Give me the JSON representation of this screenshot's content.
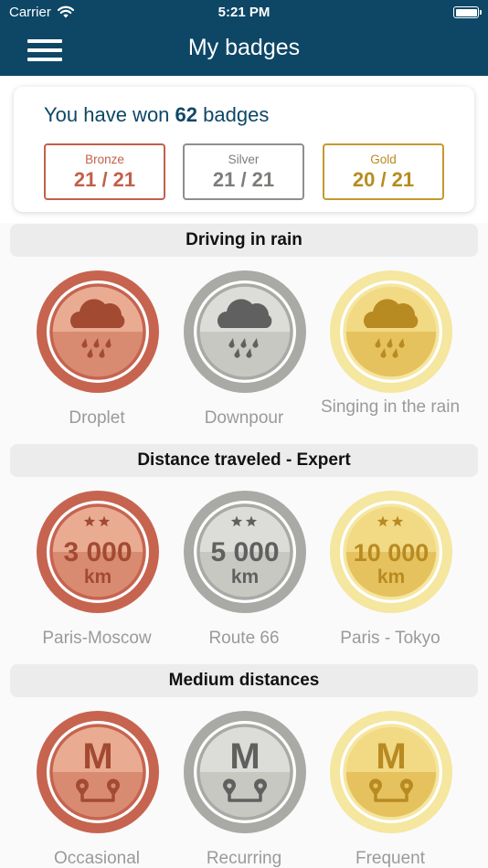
{
  "status_bar": {
    "carrier": "Carrier",
    "time": "5:21 PM",
    "wifi_icon": "wifi-icon",
    "battery_icon": "battery-icon"
  },
  "nav": {
    "title": "My badges",
    "menu_icon": "hamburger-menu-icon"
  },
  "summary": {
    "prefix": "You have won",
    "count": "62",
    "suffix": "badges",
    "tiers": [
      {
        "label": "Bronze",
        "count": "21 / 21",
        "color": "#c2604a"
      },
      {
        "label": "Silver",
        "count": "21 / 21",
        "color": "#8e8e8b"
      },
      {
        "label": "Gold",
        "count": "20 / 21",
        "color": "#c39a2e"
      }
    ]
  },
  "colors": {
    "header": "#0e4766",
    "bronze": {
      "ring": "#c66450",
      "face": "#e9ac93",
      "face_dark": "#d98b71",
      "icon": "#a34a32"
    },
    "silver": {
      "ring": "#a9a9a5",
      "face": "#dcdcd8",
      "face_dark": "#c8c8c3",
      "icon": "#606060"
    },
    "gold": {
      "ring": "#f5e6a0",
      "face": "#f2d983",
      "face_dark": "#e6c25e",
      "icon": "#b88a22"
    }
  },
  "sections": [
    {
      "title": "Driving in rain",
      "badges": [
        {
          "name": "Droplet",
          "tier": "bronze",
          "icon": "rain-cloud-icon"
        },
        {
          "name": "Downpour",
          "tier": "silver",
          "icon": "rain-cloud-icon"
        },
        {
          "name": "Singing in the rain",
          "tier": "gold",
          "icon": "rain-cloud-icon"
        }
      ]
    },
    {
      "title": "Distance traveled - Expert",
      "badges": [
        {
          "name": "Paris-Moscow",
          "tier": "bronze",
          "icon": "distance-icon",
          "value": "3 000",
          "unit": "km"
        },
        {
          "name": "Route 66",
          "tier": "silver",
          "icon": "distance-icon",
          "value": "5 000",
          "unit": "km"
        },
        {
          "name": "Paris - Tokyo",
          "tier": "gold",
          "icon": "distance-icon",
          "value": "10 000",
          "unit": "km"
        }
      ]
    },
    {
      "title": "Medium distances",
      "badges": [
        {
          "name": "Occasional",
          "tier": "bronze",
          "icon": "route-pins-icon",
          "letter": "M"
        },
        {
          "name": "Recurring",
          "tier": "silver",
          "icon": "route-pins-icon",
          "letter": "M"
        },
        {
          "name": "Frequent",
          "tier": "gold",
          "icon": "route-pins-icon",
          "letter": "M"
        }
      ]
    }
  ]
}
